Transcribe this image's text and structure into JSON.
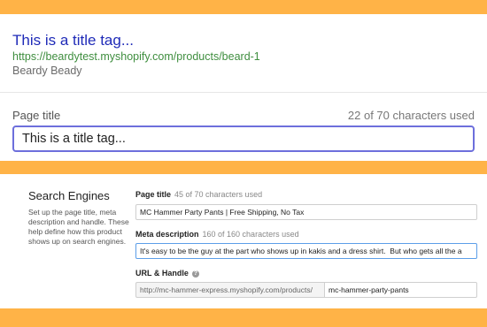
{
  "preview": {
    "title": "This is a title tag...",
    "url": "https://beardytest.myshopify.com/products/beard-1",
    "store": "Beardy Beady"
  },
  "page_title_field": {
    "label": "Page title",
    "count": "22 of 70 characters used",
    "value": "This is a title tag..."
  },
  "search_engines": {
    "heading": "Search Engines",
    "description": "Set up the page title, meta description and handle. These help define how this product shows up on search engines.",
    "page_title_label": "Page title",
    "page_title_count": "45 of 70 characters used",
    "page_title_value": "MC Hammer Party Pants | Free Shipping, No Tax",
    "meta_label": "Meta description",
    "meta_count": "160 of 160 characters used",
    "meta_value": "It's easy to be the guy at the part who shows up in kakis and a dress shirt.  But who gets all the a",
    "url_label": "URL & Handle",
    "help_icon_glyph": "?",
    "url_prefix": "http://mc-hammer-express.myshopify.com/products/",
    "url_handle": "mc-hammer-party-pants"
  },
  "colors": {
    "background": "#ffb347",
    "title_link": "#1f2bb8",
    "url_green": "#3f8e3f",
    "focus_border": "#6d6fdc"
  }
}
